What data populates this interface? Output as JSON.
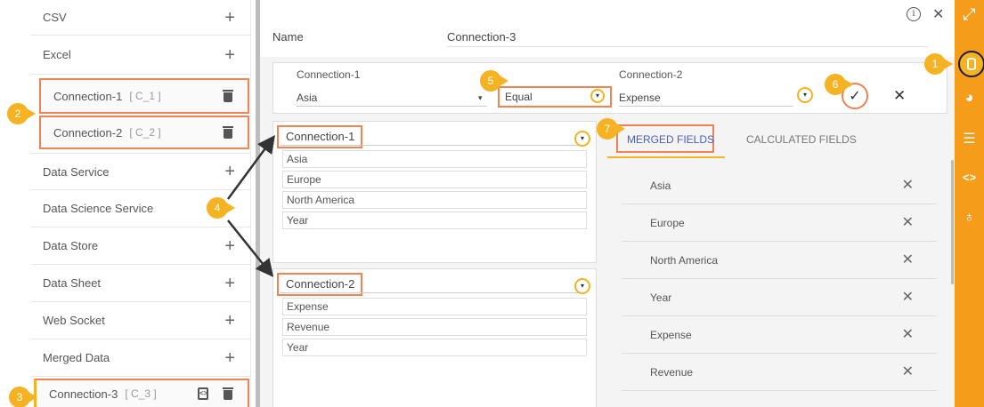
{
  "sidebar": {
    "csv": "CSV",
    "excel": "Excel",
    "plus": "+",
    "connection1": {
      "label": "Connection-1",
      "tag": "[ C_1 ]"
    },
    "connection2": {
      "label": "Connection-2",
      "tag": "[ C_2 ]"
    },
    "data_service": "Data Service",
    "data_science_service": "Data Science Service",
    "data_store": "Data Store",
    "data_sheet": "Data Sheet",
    "web_socket": "Web Socket",
    "merged_data": "Merged Data",
    "connection3": {
      "label": "Connection-3",
      "tag": "[ C_3 ]"
    }
  },
  "badges": {
    "b1": "1",
    "b2": "2",
    "b3": "3",
    "b4": "4",
    "b5": "5",
    "b6": "6",
    "b7": "7"
  },
  "header": {
    "name_label": "Name",
    "name_value": "Connection-3",
    "info": "i",
    "close": "✕"
  },
  "join": {
    "left_label": "Connection-1",
    "left_value": "Asia",
    "operator": "Equal",
    "right_label": "Connection-2",
    "right_value": "Expense",
    "caret": "▾",
    "confirm": "✓",
    "cancel": "✕"
  },
  "panel1": {
    "title": "Connection-1",
    "items": [
      "Asia",
      "Europe",
      "North America",
      "Year"
    ]
  },
  "panel2": {
    "title": "Connection-2",
    "items": [
      "Expense",
      "Revenue",
      "Year"
    ]
  },
  "tabs": {
    "merged": "MERGED FIELDS",
    "calculated": "CALCULATED FIELDS"
  },
  "merged_fields": [
    "Asia",
    "Europe",
    "North America",
    "Year",
    "Expense",
    "Revenue"
  ],
  "remove_icon": "✕",
  "colors": {
    "accent": "#f59c1a",
    "badge": "#f5b324",
    "highlight": "#ef8354",
    "tab_active": "#4a5dc2"
  },
  "rail_icons": [
    "expand-icon",
    "database-icon",
    "pie-chart-icon",
    "list-icon",
    "script-icon",
    "bulb-icon"
  ]
}
